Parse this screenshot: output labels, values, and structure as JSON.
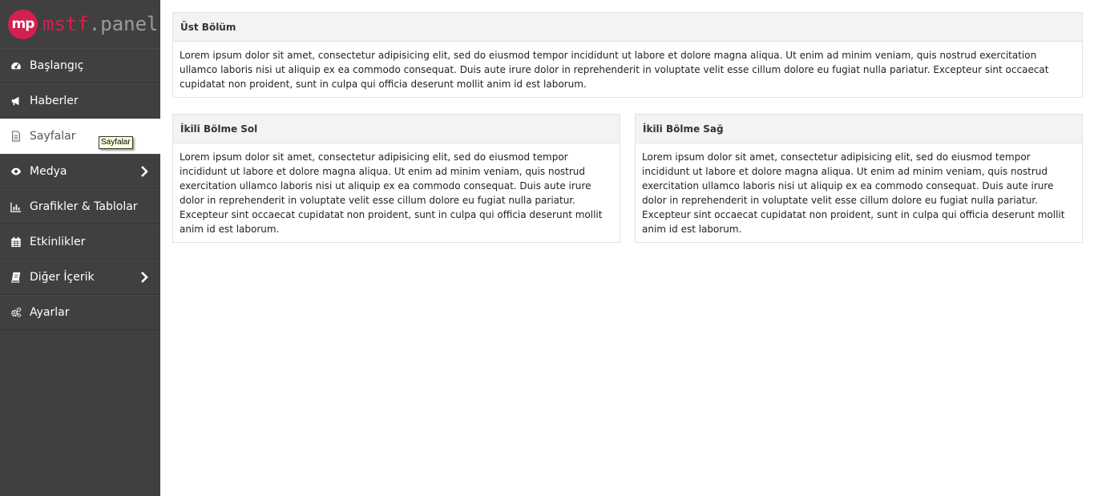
{
  "logo": {
    "mark": "mp",
    "name_a": "mstf",
    "name_b": ".panel"
  },
  "nav": [
    {
      "label": "Başlangıç",
      "icon": "dashboard-icon"
    },
    {
      "label": "Haberler",
      "icon": "bullhorn-icon"
    },
    {
      "label": "Sayfalar",
      "icon": "file-icon",
      "active": true
    },
    {
      "label": "Medya",
      "icon": "eye-icon",
      "has_submenu": true
    },
    {
      "label": "Grafikler & Tablolar",
      "icon": "bar-chart-icon"
    },
    {
      "label": "Etkinlikler",
      "icon": "calendar-icon"
    },
    {
      "label": "Diğer İçerik",
      "icon": "book-icon",
      "has_submenu": true
    },
    {
      "label": "Ayarlar",
      "icon": "cogs-icon"
    }
  ],
  "tooltip": "Sayfalar",
  "panels": {
    "top": {
      "title": "Üst Bölüm",
      "body": "Lorem ipsum dolor sit amet, consectetur adipisicing elit, sed do eiusmod tempor incididunt ut labore et dolore magna aliqua. Ut enim ad minim veniam, quis nostrud exercitation ullamco laboris nisi ut aliquip ex ea commodo consequat. Duis aute irure dolor in reprehenderit in voluptate velit esse cillum dolore eu fugiat nulla pariatur. Excepteur sint occaecat cupidatat non proident, sunt in culpa qui officia deserunt mollit anim id est laborum."
    },
    "left": {
      "title": "İkili Bölme Sol",
      "body": "Lorem ipsum dolor sit amet, consectetur adipisicing elit, sed do eiusmod tempor incididunt ut labore et dolore magna aliqua. Ut enim ad minim veniam, quis nostrud exercitation ullamco laboris nisi ut aliquip ex ea commodo consequat. Duis aute irure dolor in reprehenderit in voluptate velit esse cillum dolore eu fugiat nulla pariatur. Excepteur sint occaecat cupidatat non proident, sunt in culpa qui officia deserunt mollit anim id est laborum."
    },
    "right": {
      "title": "İkili Bölme Sağ",
      "body": "Lorem ipsum dolor sit amet, consectetur adipisicing elit, sed do eiusmod tempor incididunt ut labore et dolore magna aliqua. Ut enim ad minim veniam, quis nostrud exercitation ullamco laboris nisi ut aliquip ex ea commodo consequat. Duis aute irure dolor in reprehenderit in voluptate velit esse cillum dolore eu fugiat nulla pariatur. Excepteur sint occaecat cupidatat non proident, sunt in culpa qui officia deserunt mollit anim id est laborum."
    }
  },
  "colors": {
    "sidebar": "#404040",
    "brand": "#d3204f",
    "panel_head": "#f3f3f3"
  }
}
